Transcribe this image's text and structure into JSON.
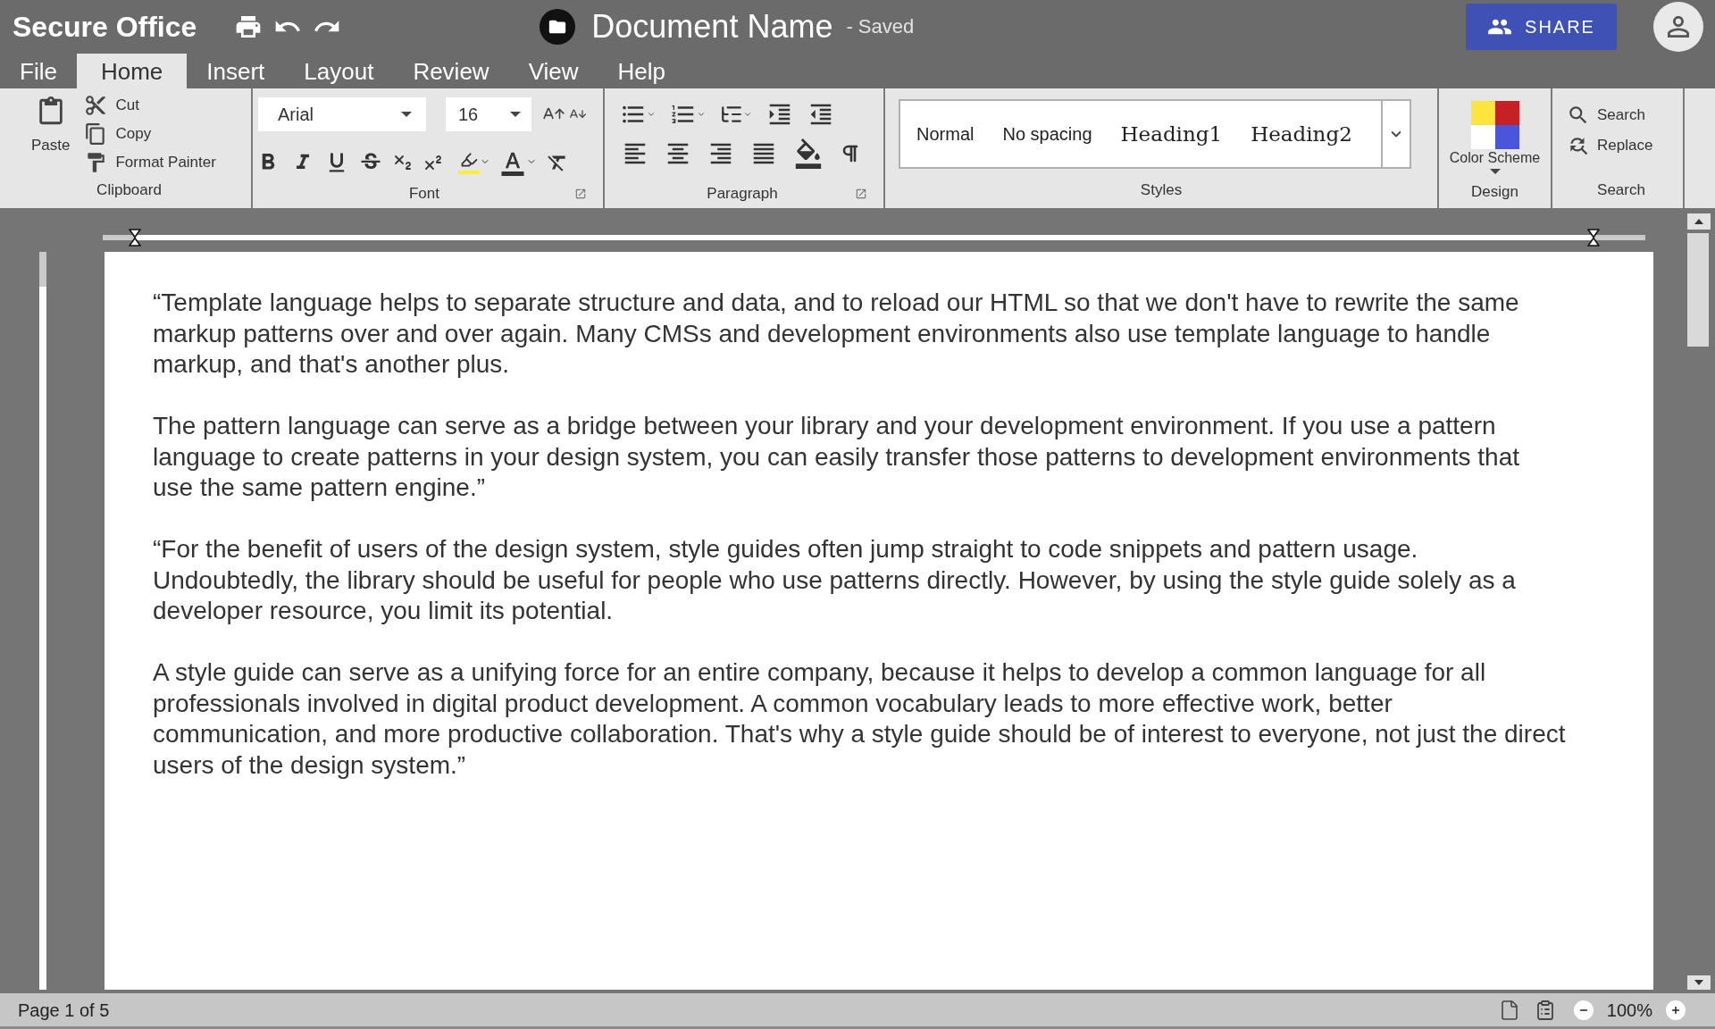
{
  "app": {
    "title": "Secure Office"
  },
  "document": {
    "name": "Document Name",
    "status": "- Saved"
  },
  "share_button": {
    "label": "SHARE"
  },
  "menu_tabs": [
    {
      "label": "File",
      "selected": false
    },
    {
      "label": "Home",
      "selected": true
    },
    {
      "label": "Insert",
      "selected": false
    },
    {
      "label": "Layout",
      "selected": false
    },
    {
      "label": "Review",
      "selected": false
    },
    {
      "label": "View",
      "selected": false
    },
    {
      "label": "Help",
      "selected": false
    }
  ],
  "ribbon": {
    "clipboard": {
      "paste": "Paste",
      "actions": [
        "Cut",
        "Copy",
        "Format Painter"
      ],
      "label": "Clipboard"
    },
    "font": {
      "family": "Arial",
      "size": "16",
      "label": "Font"
    },
    "paragraph": {
      "label": "Paragraph"
    },
    "styles": {
      "items": [
        {
          "label": "Normal",
          "kind": "body"
        },
        {
          "label": "No spacing",
          "kind": "body"
        },
        {
          "label": "Heading1",
          "kind": "heading"
        },
        {
          "label": "Heading2",
          "kind": "heading"
        }
      ],
      "label": "Styles"
    },
    "design": {
      "button": "Color Scheme",
      "label": "Design"
    },
    "search": {
      "actions": [
        "Search",
        "Replace"
      ],
      "label": "Search"
    }
  },
  "page": {
    "paragraphs": [
      "“Template language helps to separate structure and data, and to reload our HTML so that we don't have to rewrite the same markup patterns over and over again. Many CMSs and development environments also use template language to handle markup, and that's another plus.",
      "The pattern language can serve as a bridge between your library and your development environment. If you use a pattern language to create patterns in your design system, you can easily transfer those patterns to development environments that use the same pattern engine.”",
      "“For the benefit of users of the design system, style guides often jump straight to code snippets and pattern usage. Undoubtedly, the library should be useful for people who use patterns directly. However, by using the style guide solely as a developer resource, you limit its potential.",
      "A style guide can serve as a unifying force for an entire company, because it helps to develop a common language for all professionals involved in digital product development. A common vocabulary leads to more effective work, better communication, and more productive collaboration. That's why a style guide should be of interest to everyone, not just the direct users of the design system.”"
    ]
  },
  "status_bar": {
    "page": "Page 1 of 5",
    "zoom": "100%"
  }
}
